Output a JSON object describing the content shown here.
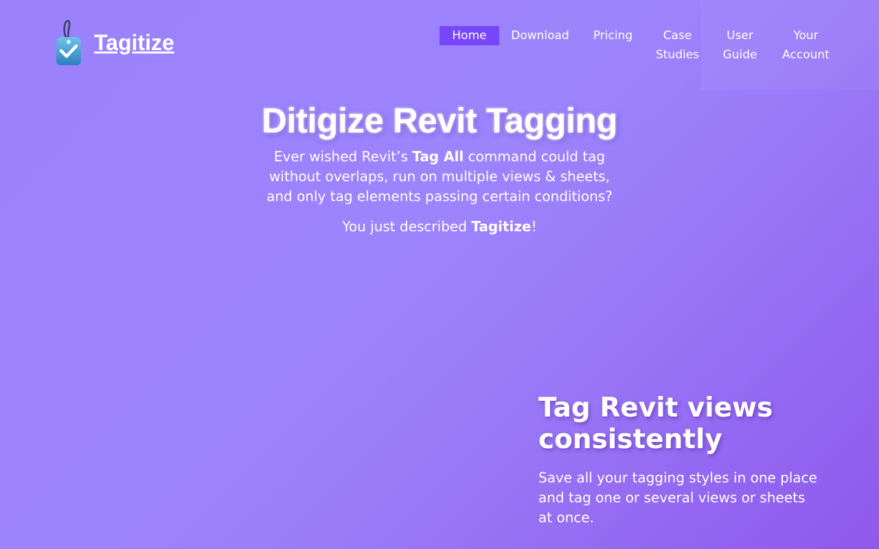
{
  "brand": {
    "name": "Tagitize",
    "logo_icon": "tag-checkmark-icon"
  },
  "nav": {
    "active": "Home",
    "items": {
      "home": "Home",
      "download": "Download",
      "pricing": "Pricing",
      "case_studies_1": "Case",
      "case_studies_2": "Studies",
      "user_guide_1": "User",
      "user_guide_2": "Guide",
      "account_1": "Your",
      "account_2": "Account"
    }
  },
  "hero": {
    "title": "Ditigize Revit Tagging",
    "line_a_pre": "Ever wished Revit’s ",
    "line_a_bold": "Tag All",
    "line_a_post": " command could tag without overlaps, run on multiple views & sheets, and only tag elements passing certain conditions?",
    "line_b_pre": "You just described ",
    "line_b_bold": "Tagitize",
    "line_b_post": "!"
  },
  "feature": {
    "title": "Tag Revit views consistently",
    "text": "Save all your tagging styles in one place and tag one or several views or sheets at once."
  },
  "colors": {
    "background_start": "#9b80fc",
    "background_end": "#8f58ec",
    "nav_active": "#7746fb",
    "text": "#ffffff"
  }
}
